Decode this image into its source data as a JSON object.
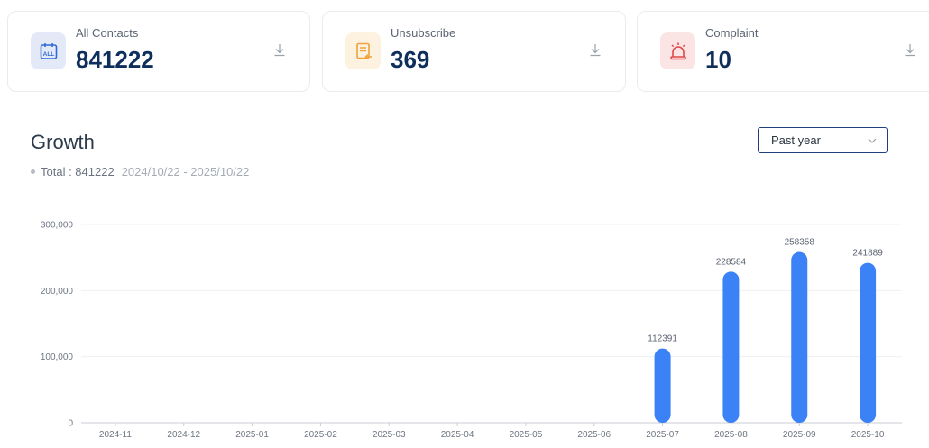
{
  "cards": [
    {
      "label": "All Contacts",
      "value": "841222",
      "icon": "calendar-all-icon",
      "icon_bg": "#e3e9f7",
      "icon_color": "#2f6bd8"
    },
    {
      "label": "Unsubscribe",
      "value": "369",
      "icon": "document-return-icon",
      "icon_bg": "#fdf1e0",
      "icon_color": "#f0a23c"
    },
    {
      "label": "Complaint",
      "value": "10",
      "icon": "alarm-siren-icon",
      "icon_bg": "#fbe4e4",
      "icon_color": "#e04848"
    }
  ],
  "calendar_icon_text": "ALL",
  "growth": {
    "title": "Growth",
    "total_text": "Total : 841222",
    "date_range": "2024/10/22 - 2025/10/22",
    "period_select": "Past year"
  },
  "chart_data": {
    "type": "bar",
    "categories": [
      "2024-11",
      "2024-12",
      "2025-01",
      "2025-02",
      "2025-03",
      "2025-04",
      "2025-05",
      "2025-06",
      "2025-07",
      "2025-08",
      "2025-09",
      "2025-10"
    ],
    "values": [
      0,
      0,
      0,
      0,
      0,
      0,
      0,
      0,
      112391,
      228584,
      258358,
      241889
    ],
    "value_labels": [
      "",
      "",
      "",
      "",
      "",
      "",
      "",
      "",
      "112391",
      "228584",
      "258358",
      "241889"
    ],
    "yticks": [
      0,
      100000,
      200000,
      300000
    ],
    "ytick_labels": [
      "0",
      "100,000",
      "200,000",
      "300,000"
    ],
    "ylim": [
      0,
      300000
    ],
    "grid": true,
    "bar_color": "#3b82f6",
    "title": "",
    "xlabel": "",
    "ylabel": ""
  }
}
